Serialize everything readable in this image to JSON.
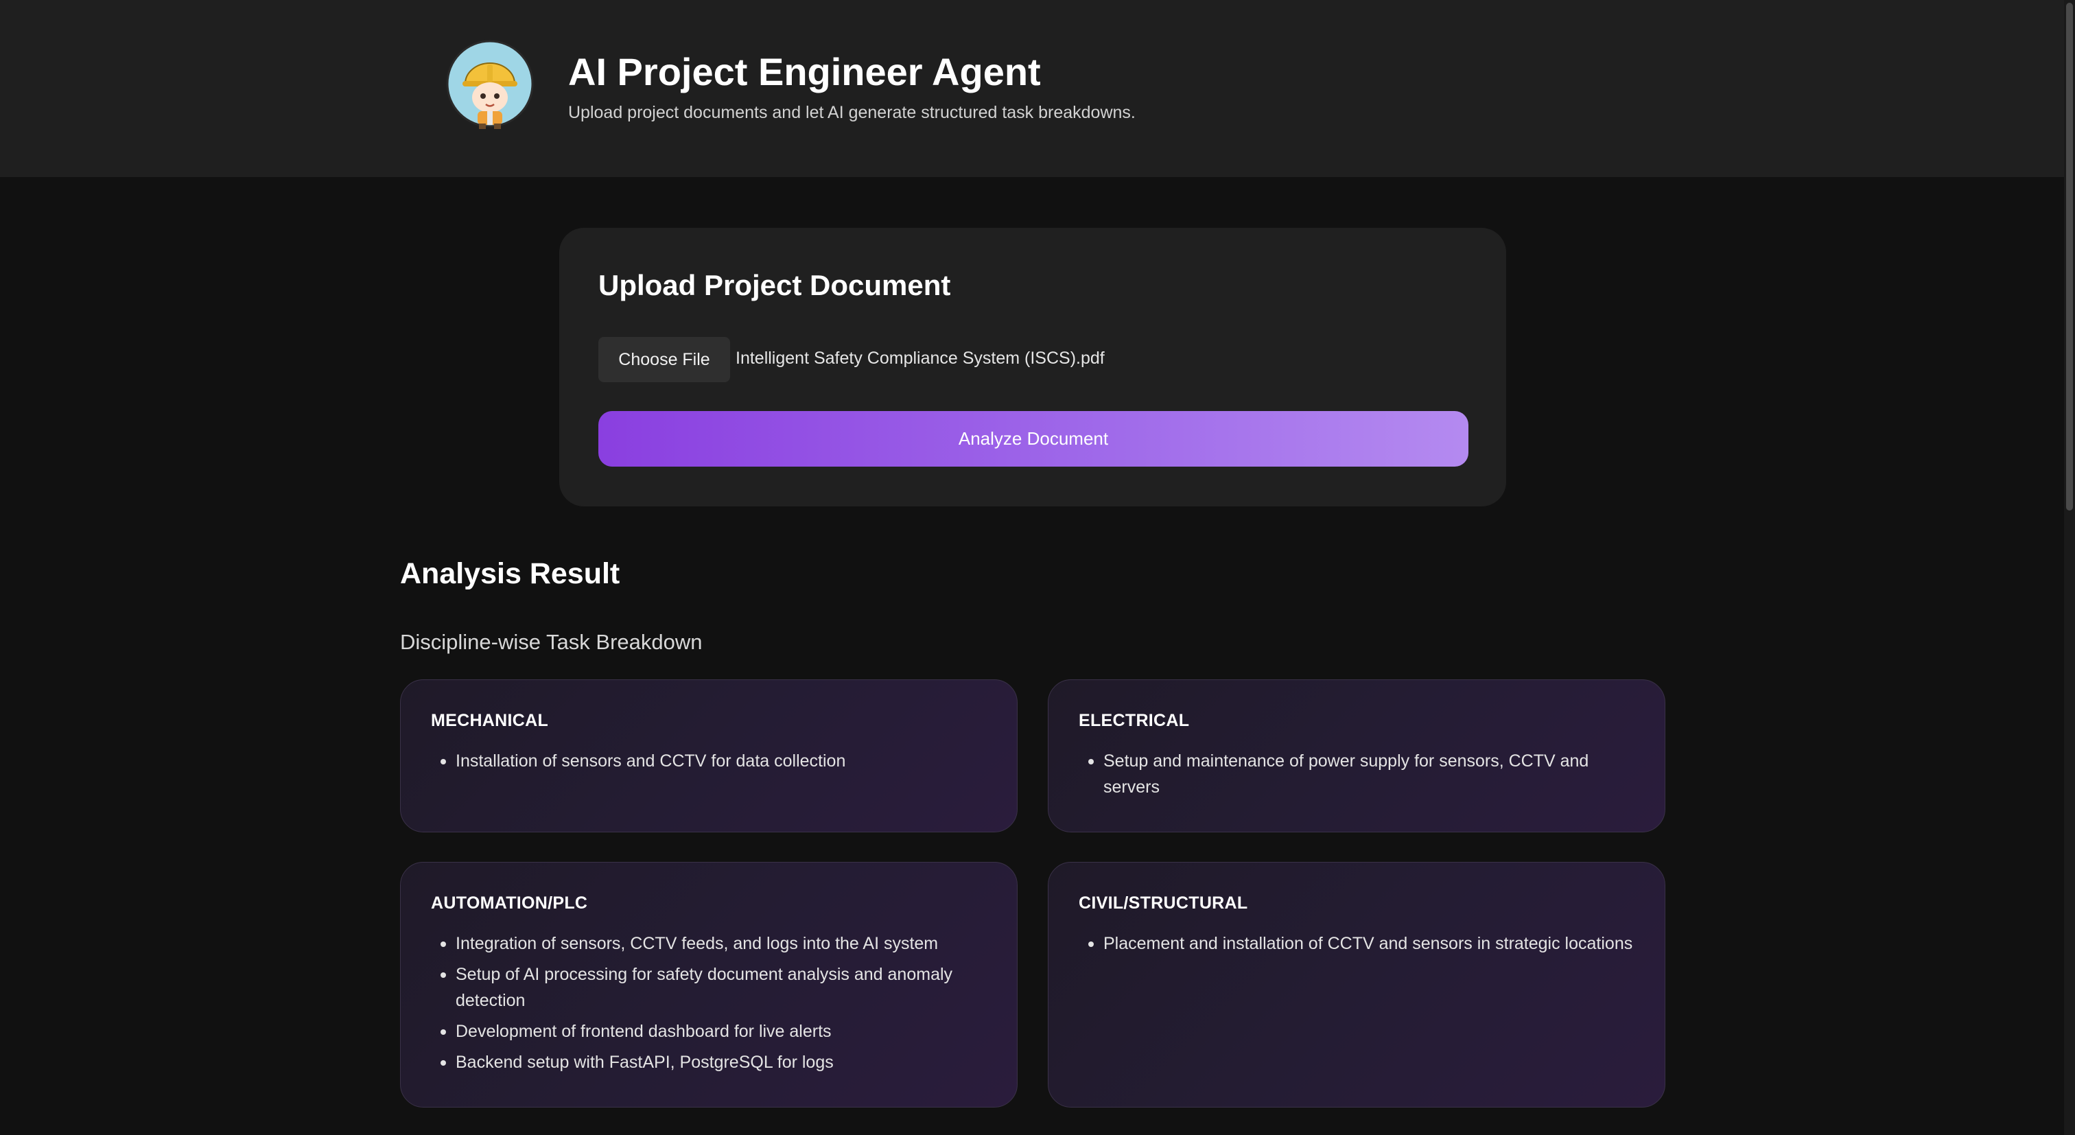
{
  "header": {
    "title": "AI Project Engineer Agent",
    "subtitle": "Upload project documents and let AI generate structured task breakdowns.",
    "avatar_icon": "construction-engineer-avatar"
  },
  "upload": {
    "title": "Upload Project Document",
    "choose_file_label": "Choose File",
    "file_name": "Intelligent Safety Compliance System (ISCS).pdf",
    "analyze_label": "Analyze Document"
  },
  "analysis": {
    "title": "Analysis Result",
    "breakdown_title": "Discipline-wise Task Breakdown",
    "disciplines": [
      {
        "name": "MECHANICAL",
        "tasks": [
          "Installation of sensors and CCTV for data collection"
        ]
      },
      {
        "name": "ELECTRICAL",
        "tasks": [
          "Setup and maintenance of power supply for sensors, CCTV and servers"
        ]
      },
      {
        "name": "AUTOMATION/PLC",
        "tasks": [
          "Integration of sensors, CCTV feeds, and logs into the AI system",
          "Setup of AI processing for safety document analysis and anomaly detection",
          "Development of frontend dashboard for live alerts",
          "Backend setup with FastAPI, PostgreSQL for logs"
        ]
      },
      {
        "name": "CIVIL/STRUCTURAL",
        "tasks": [
          "Placement and installation of CCTV and sensors in strategic locations"
        ]
      }
    ]
  },
  "colors": {
    "accent_start": "#8a3fe0",
    "accent_end": "#b48af0",
    "background": "#111111",
    "header_bg": "#1f1f1f"
  }
}
